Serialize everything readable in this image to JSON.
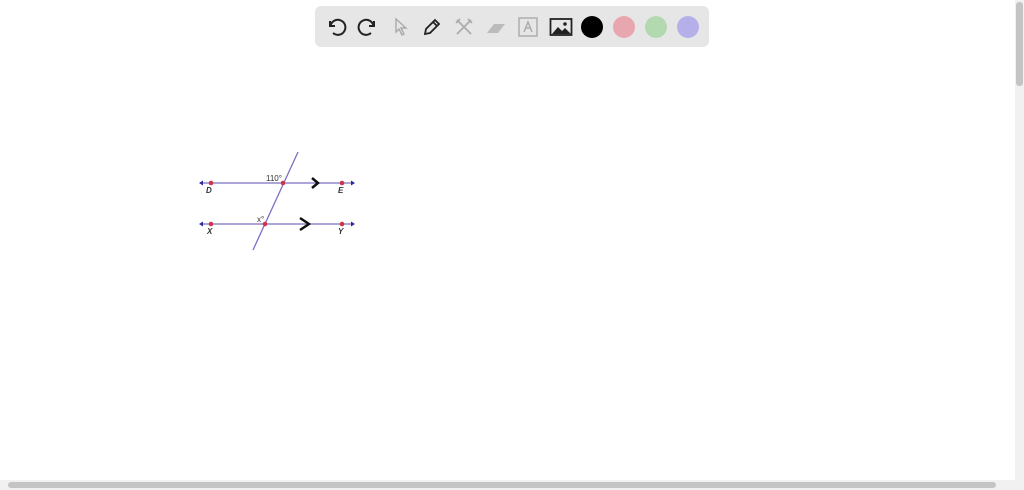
{
  "toolbar": {
    "tools": [
      "undo-icon",
      "redo-icon",
      "select-icon",
      "pen-icon",
      "tools-icon",
      "eraser-icon",
      "text-icon",
      "image-icon"
    ],
    "colors": [
      "#000000",
      "#e8a6ae",
      "#b3d9b0",
      "#b5b0ea"
    ]
  },
  "diagram": {
    "angle_top": "110°",
    "angle_bottom": "x°",
    "points": {
      "d": "D",
      "e": "E",
      "x": "X",
      "y": "Y"
    },
    "line_color": "#7b6fc0",
    "point_color": "#d0334a"
  }
}
